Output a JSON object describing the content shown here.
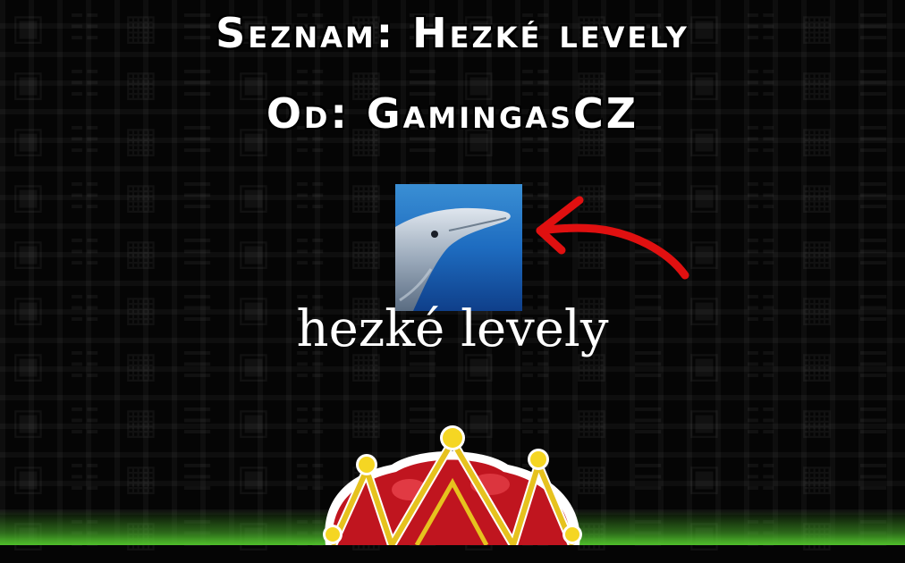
{
  "header": {
    "title": "Seznam: Hezké levely",
    "author_line": "Od: GamingasCZ"
  },
  "level": {
    "thumbnail": "dolphin-photo",
    "caption": "hezké levely"
  },
  "annotation": {
    "icon": "red-arrow-icon",
    "color": "#e01010"
  },
  "background": {
    "base_color": "#050505",
    "glow_color": "#4fbf2a"
  }
}
